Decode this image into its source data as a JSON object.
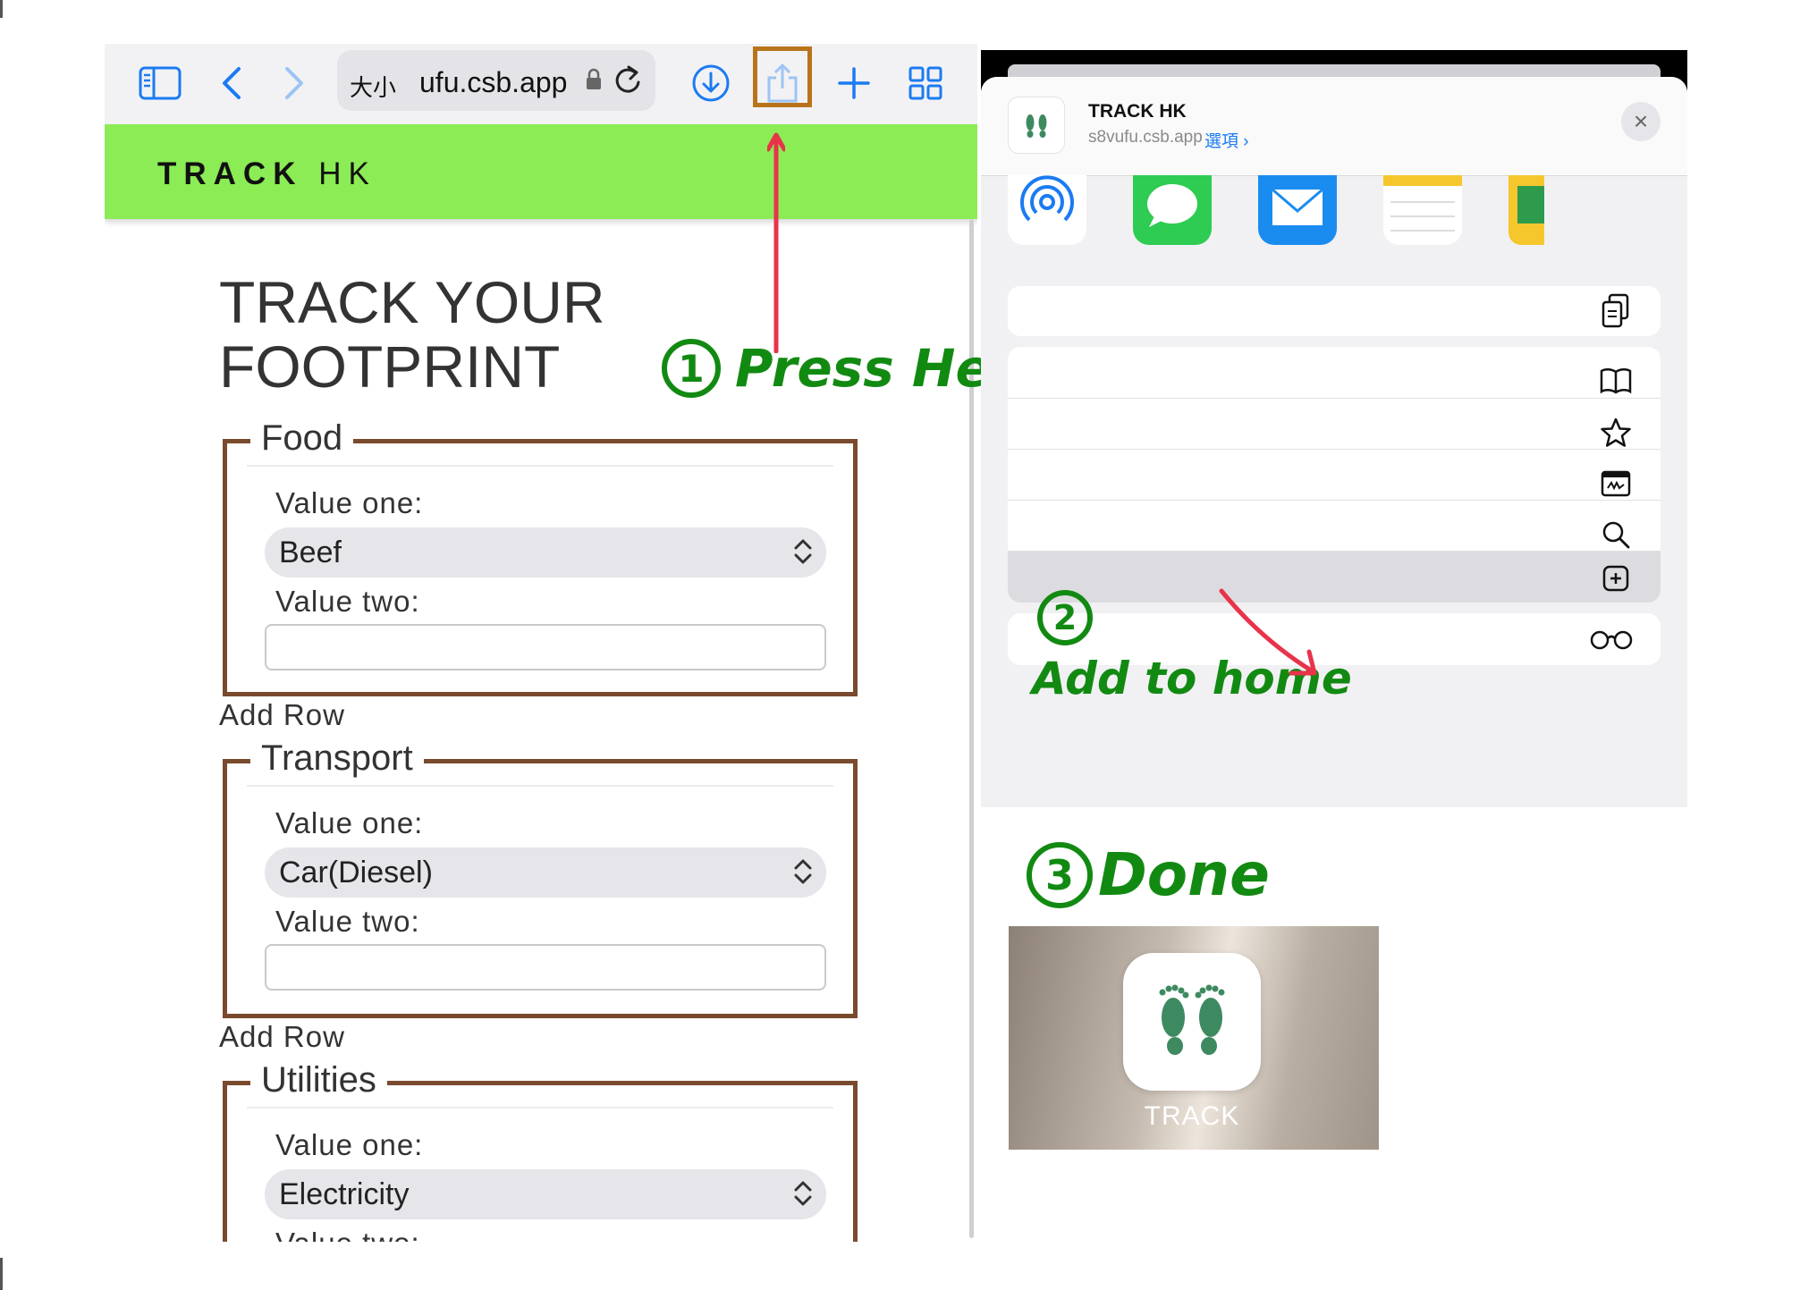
{
  "browser": {
    "url_text_size": "大小",
    "url": "ufu.csb.app",
    "site_logo_bold": "TRACK",
    "site_logo_rest": "HK"
  },
  "page": {
    "title_line1": "TRACK YOUR",
    "title_line2": "FOOTPRINT",
    "sections": [
      {
        "legend": "Food",
        "value_one_label": "Value one:",
        "value_one": "Beef",
        "value_two_label": "Value two:",
        "value_two": "",
        "add_row": "Add Row"
      },
      {
        "legend": "Transport",
        "value_one_label": "Value one:",
        "value_one": "Car(Diesel)",
        "value_two_label": "Value two:",
        "value_two": "",
        "add_row": "Add Row"
      },
      {
        "legend": "Utilities",
        "value_one_label": "Value one:",
        "value_one": "Electricity",
        "value_two_label": "Value two:"
      }
    ]
  },
  "annotations": {
    "step1_number": "1",
    "step1_text": "Press Here",
    "step2_number": "2",
    "step2_text": "Add to home",
    "step3_number": "3",
    "step3_text": "Done",
    "highlight_color": "#b8741a",
    "arrow_color": "#e8334a",
    "annotation_color": "#128a12"
  },
  "share_sheet": {
    "title": "TRACK HK",
    "url": "s8vufu.csb.app",
    "options_label": "選項 ›",
    "close_label": "×",
    "apps": [
      "airdrop-icon",
      "messages-icon",
      "mail-icon",
      "notes-icon",
      "more-app-icon"
    ],
    "actions": [
      {
        "icon": "copy-icon"
      },
      {
        "icon": "book-icon"
      },
      {
        "icon": "star-icon"
      },
      {
        "icon": "markup-icon"
      },
      {
        "icon": "search-icon"
      },
      {
        "icon": "add-square-icon",
        "highlighted": true
      },
      {
        "icon": "glasses-icon"
      }
    ]
  },
  "home_screen": {
    "app_label": "TRACK"
  }
}
